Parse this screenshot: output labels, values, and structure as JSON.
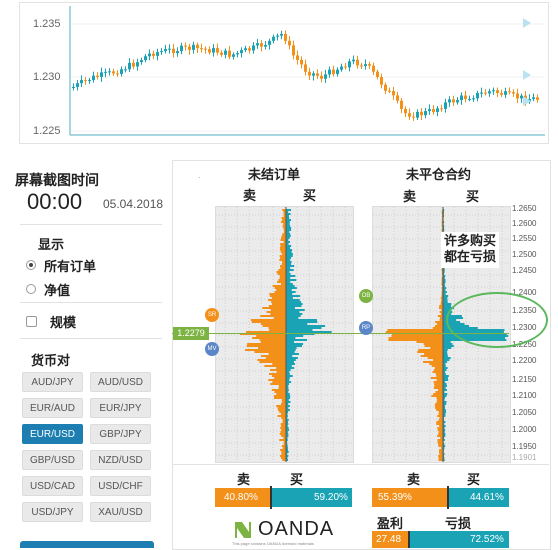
{
  "top_chart": {
    "y_ticks": [
      "1.235",
      "1.230",
      "1.225"
    ],
    "arrow_color": "#b8e3ef"
  },
  "left_panel": {
    "screenshot_time_label": "屏幕截图时间",
    "time": "00:00",
    "date": "05.04.2018",
    "display_label": "显示",
    "option_all_orders": "所有订单",
    "option_net": "净值",
    "scale_label": "规模",
    "currency_pair_label": "货币对",
    "pairs": [
      "AUD/JPY",
      "AUD/USD",
      "EUR/AUD",
      "EUR/JPY",
      "EUR/USD",
      "GBP/JPY",
      "GBP/USD",
      "NZD/USD",
      "USD/CAD",
      "USD/CHF",
      "USD/JPY",
      "XAU/USD"
    ],
    "active_pair": "EUR/USD"
  },
  "right_panel": {
    "open_orders_title": "未结订单",
    "open_positions_title": "未平仓合约",
    "sell": "卖",
    "buy": "买",
    "current_price": "1.2279",
    "tag_sr": "SR",
    "tag_mv": "MV",
    "tag_ob": "OB",
    "tag_rp": "RP",
    "annotation_line1": "许多购买",
    "annotation_line2": "都在亏损",
    "y_axis_labels": [
      "1.2650",
      "1.2600",
      "1.2550",
      "1.2500",
      "1.2450",
      "1.2400",
      "1.2350",
      "1.2300",
      "1.2250",
      "1.2200",
      "1.2150",
      "1.2100",
      "1.2050",
      "1.2000",
      "1.1950",
      "1.1901"
    ],
    "orders_sell_pct": "40.80%",
    "orders_buy_pct": "59.20%",
    "positions_sell_pct": "55.39%",
    "positions_buy_pct": "44.61%",
    "profit_label": "盈利",
    "loss_label": "亏损",
    "profit_pct": "27.48",
    "loss_pct": "72.52%",
    "logo": "OANDA",
    "logo_subtext": "This page contains OANDA licensed materials",
    "colors": {
      "sell": "#f39019",
      "buy": "#1aa3b5",
      "price_line": "#7cb342",
      "annotation": "#5cb85c"
    }
  }
}
